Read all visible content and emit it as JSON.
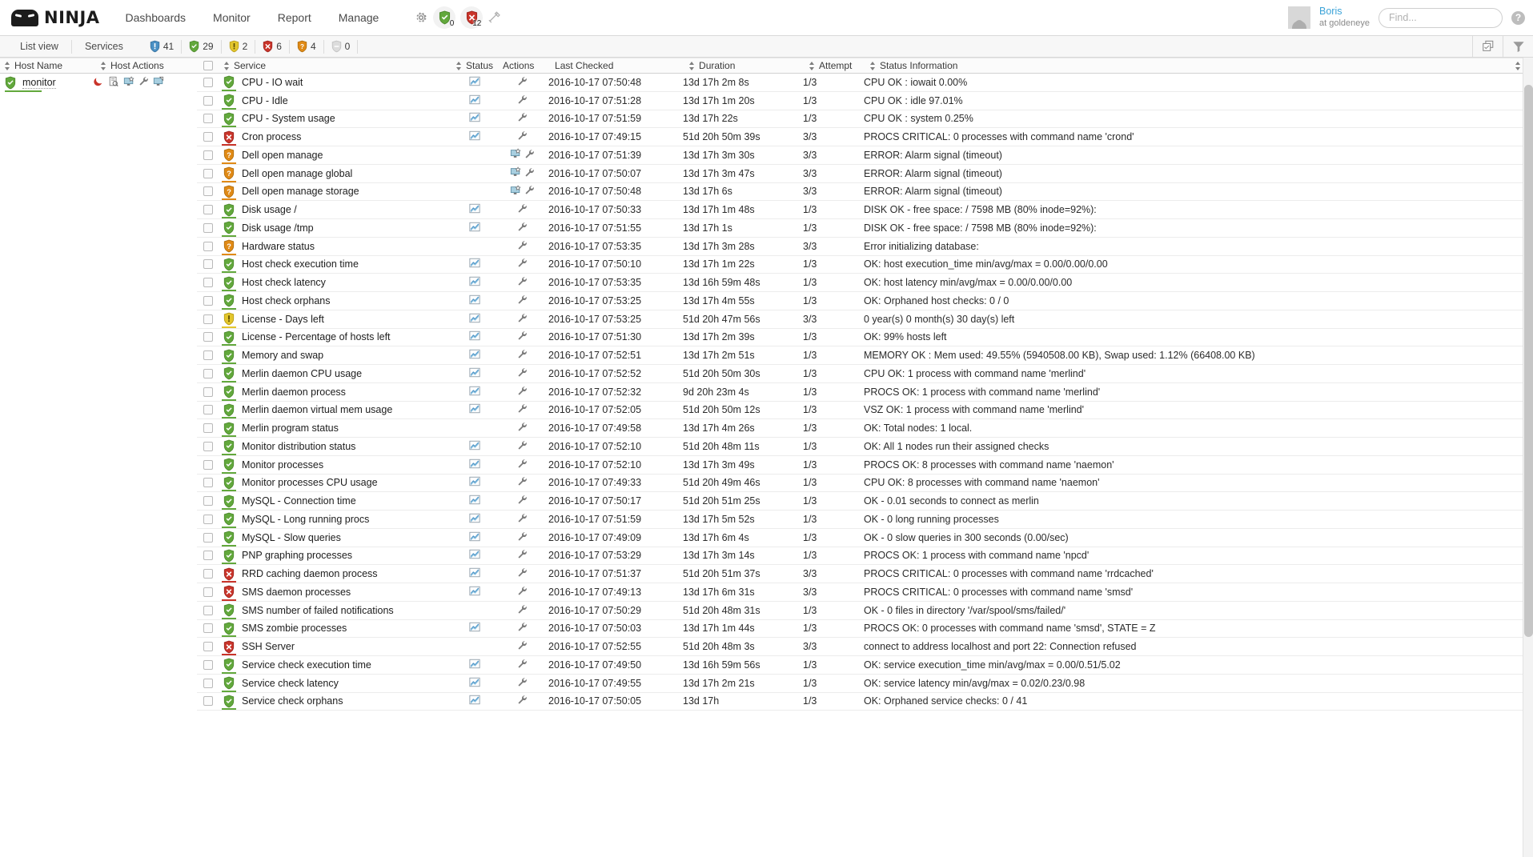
{
  "app": {
    "logo_text": "NINJA"
  },
  "nav": {
    "links": [
      {
        "label": "Dashboards",
        "name": "nav-dashboards"
      },
      {
        "label": "Monitor",
        "name": "nav-monitor"
      },
      {
        "label": "Report",
        "name": "nav-report"
      },
      {
        "label": "Manage",
        "name": "nav-manage"
      }
    ],
    "gear_icon": "gear-icon",
    "ok_badge": {
      "icon": "shield-ok-icon",
      "count": "0"
    },
    "critical_badge": {
      "icon": "shield-critical-icon",
      "count": "12"
    },
    "link_icon": "link-icon"
  },
  "user": {
    "name": "Boris",
    "subtitle": "at goldeneye",
    "avatar": "avatar-icon"
  },
  "search": {
    "placeholder": "Find...",
    "value": ""
  },
  "help": {
    "label": "?"
  },
  "subbar": {
    "list_view": "List view",
    "services": "Services",
    "counts": [
      {
        "icon": "shield-info-icon",
        "color": "#4a90c4",
        "value": "41"
      },
      {
        "icon": "shield-ok-icon",
        "color": "#62a83c",
        "value": "29"
      },
      {
        "icon": "shield-warning-icon",
        "color": "#e3c62c",
        "value": "2"
      },
      {
        "icon": "shield-critical-icon",
        "color": "#c9342a",
        "value": "6"
      },
      {
        "icon": "shield-unknown-icon",
        "color": "#e08a16",
        "value": "4"
      },
      {
        "icon": "shield-pending-icon",
        "color": "#cccccc",
        "value": "0"
      }
    ],
    "copy_icon": "copy-icon",
    "filter_icon": "filter-icon"
  },
  "table": {
    "host_headers": [
      {
        "label": "Host Name",
        "sortable": true,
        "name": "header-host-name"
      },
      {
        "label": "Host Actions",
        "sortable": true,
        "name": "header-host-actions"
      }
    ],
    "service_headers": [
      {
        "label": "Service",
        "sortable": true,
        "name": "header-service"
      },
      {
        "label": "Status",
        "sortable": true,
        "name": "header-status"
      },
      {
        "label": "Actions",
        "sortable": false,
        "name": "header-actions"
      },
      {
        "label": "Last Checked",
        "sortable": false,
        "name": "header-last-checked"
      },
      {
        "label": "Duration",
        "sortable": true,
        "name": "header-duration"
      },
      {
        "label": "Attempt",
        "sortable": true,
        "name": "header-attempt"
      },
      {
        "label": "Status Information",
        "sortable": true,
        "name": "header-status-information"
      }
    ]
  },
  "host": {
    "name": "monitor",
    "state": "ok",
    "actions": [
      "moon-downtime-icon",
      "clipboard-icon",
      "monitor-star-icon",
      "wrench-icon",
      "monitor-edit-icon"
    ]
  },
  "services": [
    {
      "name": "CPU - IO wait",
      "state": "ok",
      "graph": true,
      "actions": [
        "wrench-icon"
      ],
      "last_checked": "2016-10-17 07:50:48",
      "duration": "13d 17h 2m 8s",
      "attempt": "1/3",
      "info": "CPU OK : iowait 0.00%"
    },
    {
      "name": "CPU - Idle",
      "state": "ok",
      "graph": true,
      "actions": [
        "wrench-icon"
      ],
      "last_checked": "2016-10-17 07:51:28",
      "duration": "13d 17h 1m 20s",
      "attempt": "1/3",
      "info": "CPU OK : idle 97.01%"
    },
    {
      "name": "CPU - System usage",
      "state": "ok",
      "graph": true,
      "actions": [
        "wrench-icon"
      ],
      "last_checked": "2016-10-17 07:51:59",
      "duration": "13d 17h 22s",
      "attempt": "1/3",
      "info": "CPU OK : system 0.25%"
    },
    {
      "name": "Cron process",
      "state": "critical",
      "graph": true,
      "actions": [
        "wrench-icon"
      ],
      "last_checked": "2016-10-17 07:49:15",
      "duration": "51d 20h 50m 39s",
      "attempt": "3/3",
      "info": "PROCS CRITICAL: 0 processes with command name 'crond'"
    },
    {
      "name": "Dell open manage",
      "state": "unknown",
      "graph": false,
      "actions": [
        "monitor-star-icon",
        "wrench-icon"
      ],
      "last_checked": "2016-10-17 07:51:39",
      "duration": "13d 17h 3m 30s",
      "attempt": "3/3",
      "info": "ERROR: Alarm signal (timeout)"
    },
    {
      "name": "Dell open manage global",
      "state": "unknown",
      "graph": false,
      "actions": [
        "monitor-star-icon",
        "wrench-icon"
      ],
      "last_checked": "2016-10-17 07:50:07",
      "duration": "13d 17h 3m 47s",
      "attempt": "3/3",
      "info": "ERROR: Alarm signal (timeout)"
    },
    {
      "name": "Dell open manage storage",
      "state": "unknown",
      "graph": false,
      "actions": [
        "monitor-star-icon",
        "wrench-icon"
      ],
      "last_checked": "2016-10-17 07:50:48",
      "duration": "13d 17h 6s",
      "attempt": "3/3",
      "info": "ERROR: Alarm signal (timeout)"
    },
    {
      "name": "Disk usage /",
      "state": "ok",
      "graph": true,
      "actions": [
        "wrench-icon"
      ],
      "last_checked": "2016-10-17 07:50:33",
      "duration": "13d 17h 1m 48s",
      "attempt": "1/3",
      "info": "DISK OK - free space: / 7598 MB (80% inode=92%):"
    },
    {
      "name": "Disk usage /tmp",
      "state": "ok",
      "graph": true,
      "actions": [
        "wrench-icon"
      ],
      "last_checked": "2016-10-17 07:51:55",
      "duration": "13d 17h 1s",
      "attempt": "1/3",
      "info": "DISK OK - free space: / 7598 MB (80% inode=92%):"
    },
    {
      "name": "Hardware status",
      "state": "unknown",
      "graph": false,
      "actions": [
        "wrench-icon"
      ],
      "last_checked": "2016-10-17 07:53:35",
      "duration": "13d 17h 3m 28s",
      "attempt": "3/3",
      "info": "Error initializing database:"
    },
    {
      "name": "Host check execution time",
      "state": "ok",
      "graph": true,
      "actions": [
        "wrench-icon"
      ],
      "last_checked": "2016-10-17 07:50:10",
      "duration": "13d 17h 1m 22s",
      "attempt": "1/3",
      "info": "OK: host execution_time min/avg/max = 0.00/0.00/0.00"
    },
    {
      "name": "Host check latency",
      "state": "ok",
      "graph": true,
      "actions": [
        "wrench-icon"
      ],
      "last_checked": "2016-10-17 07:53:35",
      "duration": "13d 16h 59m 48s",
      "attempt": "1/3",
      "info": "OK: host latency min/avg/max = 0.00/0.00/0.00"
    },
    {
      "name": "Host check orphans",
      "state": "ok",
      "graph": true,
      "actions": [
        "wrench-icon"
      ],
      "last_checked": "2016-10-17 07:53:25",
      "duration": "13d 17h 4m 55s",
      "attempt": "1/3",
      "info": "OK: Orphaned host checks: 0 / 0"
    },
    {
      "name": "License - Days left",
      "state": "warning",
      "graph": true,
      "actions": [
        "wrench-icon"
      ],
      "last_checked": "2016-10-17 07:53:25",
      "duration": "51d 20h 47m 56s",
      "attempt": "3/3",
      "info": "0 year(s) 0 month(s) 30 day(s) left"
    },
    {
      "name": "License - Percentage of hosts left",
      "state": "ok",
      "graph": true,
      "actions": [
        "wrench-icon"
      ],
      "last_checked": "2016-10-17 07:51:30",
      "duration": "13d 17h 2m 39s",
      "attempt": "1/3",
      "info": "OK: 99% hosts left"
    },
    {
      "name": "Memory and swap",
      "state": "ok",
      "graph": true,
      "actions": [
        "wrench-icon"
      ],
      "last_checked": "2016-10-17 07:52:51",
      "duration": "13d 17h 2m 51s",
      "attempt": "1/3",
      "info": "MEMORY OK : Mem used: 49.55% (5940508.00 KB), Swap used: 1.12% (66408.00 KB)"
    },
    {
      "name": "Merlin daemon CPU usage",
      "state": "ok",
      "graph": true,
      "actions": [
        "wrench-icon"
      ],
      "last_checked": "2016-10-17 07:52:52",
      "duration": "51d 20h 50m 30s",
      "attempt": "1/3",
      "info": "CPU OK: 1 process with command name 'merlind'"
    },
    {
      "name": "Merlin daemon process",
      "state": "ok",
      "graph": true,
      "actions": [
        "wrench-icon"
      ],
      "last_checked": "2016-10-17 07:52:32",
      "duration": "9d 20h 23m 4s",
      "attempt": "1/3",
      "info": "PROCS OK: 1 process with command name 'merlind'"
    },
    {
      "name": "Merlin daemon virtual mem usage",
      "state": "ok",
      "graph": true,
      "actions": [
        "wrench-icon"
      ],
      "last_checked": "2016-10-17 07:52:05",
      "duration": "51d 20h 50m 12s",
      "attempt": "1/3",
      "info": "VSZ OK: 1 process with command name 'merlind'"
    },
    {
      "name": "Merlin program status",
      "state": "ok",
      "graph": false,
      "actions": [
        "wrench-icon"
      ],
      "last_checked": "2016-10-17 07:49:58",
      "duration": "13d 17h 4m 26s",
      "attempt": "1/3",
      "info": "OK: Total nodes: 1 local."
    },
    {
      "name": "Monitor distribution status",
      "state": "ok",
      "graph": true,
      "actions": [
        "wrench-icon"
      ],
      "last_checked": "2016-10-17 07:52:10",
      "duration": "51d 20h 48m 11s",
      "attempt": "1/3",
      "info": "OK: All 1 nodes run their assigned checks"
    },
    {
      "name": "Monitor processes",
      "state": "ok",
      "graph": true,
      "actions": [
        "wrench-icon"
      ],
      "last_checked": "2016-10-17 07:52:10",
      "duration": "13d 17h 3m 49s",
      "attempt": "1/3",
      "info": "PROCS OK: 8 processes with command name 'naemon'"
    },
    {
      "name": "Monitor processes CPU usage",
      "state": "ok",
      "graph": true,
      "actions": [
        "wrench-icon"
      ],
      "last_checked": "2016-10-17 07:49:33",
      "duration": "51d 20h 49m 46s",
      "attempt": "1/3",
      "info": "CPU OK: 8 processes with command name 'naemon'"
    },
    {
      "name": "MySQL - Connection time",
      "state": "ok",
      "graph": true,
      "actions": [
        "wrench-icon"
      ],
      "last_checked": "2016-10-17 07:50:17",
      "duration": "51d 20h 51m 25s",
      "attempt": "1/3",
      "info": "OK - 0.01 seconds to connect as merlin"
    },
    {
      "name": "MySQL - Long running procs",
      "state": "ok",
      "graph": true,
      "actions": [
        "wrench-icon"
      ],
      "last_checked": "2016-10-17 07:51:59",
      "duration": "13d 17h 5m 52s",
      "attempt": "1/3",
      "info": "OK - 0 long running processes"
    },
    {
      "name": "MySQL - Slow queries",
      "state": "ok",
      "graph": true,
      "actions": [
        "wrench-icon"
      ],
      "last_checked": "2016-10-17 07:49:09",
      "duration": "13d 17h 6m 4s",
      "attempt": "1/3",
      "info": "OK - 0 slow queries in 300 seconds (0.00/sec)"
    },
    {
      "name": "PNP graphing processes",
      "state": "ok",
      "graph": true,
      "actions": [
        "wrench-icon"
      ],
      "last_checked": "2016-10-17 07:53:29",
      "duration": "13d 17h 3m 14s",
      "attempt": "1/3",
      "info": "PROCS OK: 1 process with command name 'npcd'"
    },
    {
      "name": "RRD caching daemon process",
      "state": "critical",
      "graph": true,
      "actions": [
        "wrench-icon"
      ],
      "last_checked": "2016-10-17 07:51:37",
      "duration": "51d 20h 51m 37s",
      "attempt": "3/3",
      "info": "PROCS CRITICAL: 0 processes with command name 'rrdcached'"
    },
    {
      "name": "SMS daemon processes",
      "state": "critical",
      "graph": true,
      "actions": [
        "wrench-icon"
      ],
      "last_checked": "2016-10-17 07:49:13",
      "duration": "13d 17h 6m 31s",
      "attempt": "3/3",
      "info": "PROCS CRITICAL: 0 processes with command name 'smsd'"
    },
    {
      "name": "SMS number of failed notifications",
      "state": "ok",
      "graph": false,
      "actions": [
        "wrench-icon"
      ],
      "last_checked": "2016-10-17 07:50:29",
      "duration": "51d 20h 48m 31s",
      "attempt": "1/3",
      "info": "OK - 0 files in directory '/var/spool/sms/failed/'"
    },
    {
      "name": "SMS zombie processes",
      "state": "ok",
      "graph": true,
      "actions": [
        "wrench-icon"
      ],
      "last_checked": "2016-10-17 07:50:03",
      "duration": "13d 17h 1m 44s",
      "attempt": "1/3",
      "info": "PROCS OK: 0 processes with command name 'smsd', STATE = Z"
    },
    {
      "name": "SSH Server",
      "state": "critical",
      "graph": false,
      "actions": [
        "wrench-icon"
      ],
      "last_checked": "2016-10-17 07:52:55",
      "duration": "51d 20h 48m 3s",
      "attempt": "3/3",
      "info": "connect to address localhost and port 22: Connection refused"
    },
    {
      "name": "Service check execution time",
      "state": "ok",
      "graph": true,
      "actions": [
        "wrench-icon"
      ],
      "last_checked": "2016-10-17 07:49:50",
      "duration": "13d 16h 59m 56s",
      "attempt": "1/3",
      "info": "OK: service execution_time min/avg/max = 0.00/0.51/5.02"
    },
    {
      "name": "Service check latency",
      "state": "ok",
      "graph": true,
      "actions": [
        "wrench-icon"
      ],
      "last_checked": "2016-10-17 07:49:55",
      "duration": "13d 17h 2m 21s",
      "attempt": "1/3",
      "info": "OK: service latency min/avg/max = 0.02/0.23/0.98"
    },
    {
      "name": "Service check orphans",
      "state": "ok",
      "graph": true,
      "actions": [
        "wrench-icon"
      ],
      "last_checked": "2016-10-17 07:50:05",
      "duration": "13d 17h",
      "attempt": "1/3",
      "info": "OK: Orphaned service checks: 0 / 41"
    }
  ],
  "state_colors": {
    "ok": "#62a83c",
    "warning": "#e3c62c",
    "critical": "#c9342a",
    "unknown": "#e08a16",
    "info": "#4a90c4",
    "pending": "#cccccc"
  }
}
